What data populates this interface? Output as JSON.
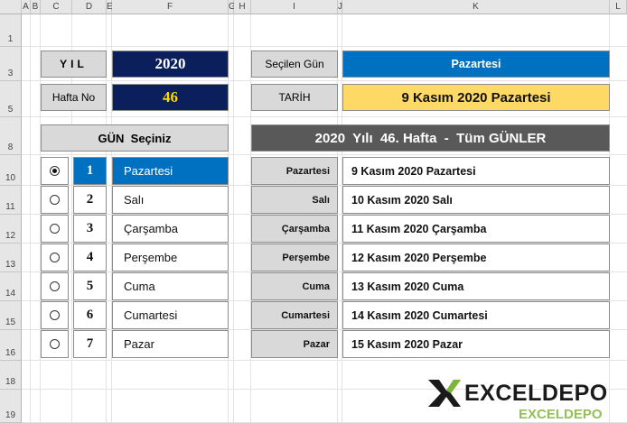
{
  "columns": [
    "A",
    "B",
    "C",
    "D",
    "E",
    "F",
    "G",
    "H",
    "I",
    "J",
    "K",
    "L"
  ],
  "rows": [
    "1",
    "3",
    "5",
    "8",
    "10",
    "11",
    "12",
    "13",
    "14",
    "15",
    "16",
    "18",
    "19"
  ],
  "year": {
    "label": "YIL",
    "value": "2020"
  },
  "week": {
    "label": "Hafta No",
    "value": "46"
  },
  "selected_day": {
    "label": "Seçilen Gün",
    "value": "Pazartesi"
  },
  "date": {
    "label": "TARİH",
    "value": "9 Kasım 2020 Pazartesi"
  },
  "day_picker": {
    "header": "GÜN  Seçiniz",
    "selected_index": 0,
    "days": [
      {
        "num": "1",
        "name": "Pazartesi"
      },
      {
        "num": "2",
        "name": "Salı"
      },
      {
        "num": "3",
        "name": "Çarşamba"
      },
      {
        "num": "4",
        "name": "Perşembe"
      },
      {
        "num": "5",
        "name": "Cuma"
      },
      {
        "num": "6",
        "name": "Cumartesi"
      },
      {
        "num": "7",
        "name": "Pazar"
      }
    ]
  },
  "week_table": {
    "header": "2020  Yılı  46. Hafta  -  Tüm GÜNLER",
    "rows": [
      {
        "day": "Pazartesi",
        "date": "9 Kasım 2020 Pazartesi"
      },
      {
        "day": "Salı",
        "date": "10 Kasım 2020 Salı"
      },
      {
        "day": "Çarşamba",
        "date": "11 Kasım 2020 Çarşamba"
      },
      {
        "day": "Perşembe",
        "date": "12 Kasım 2020 Perşembe"
      },
      {
        "day": "Cuma",
        "date": "13 Kasım 2020 Cuma"
      },
      {
        "day": "Cumartesi",
        "date": "14 Kasım 2020 Cumartesi"
      },
      {
        "day": "Pazar",
        "date": "15 Kasım 2020 Pazar"
      }
    ]
  },
  "logo": {
    "text_top": "EXCELDEPO",
    "text_bottom": "EXCELDEPO"
  },
  "colors": {
    "navy": "#0b1f5c",
    "selected_blue": "#0070c0",
    "date_yellow": "#ffd966",
    "header_dark": "#595959",
    "grey_fill": "#d9d9d9",
    "logo_green": "#7fb539"
  }
}
